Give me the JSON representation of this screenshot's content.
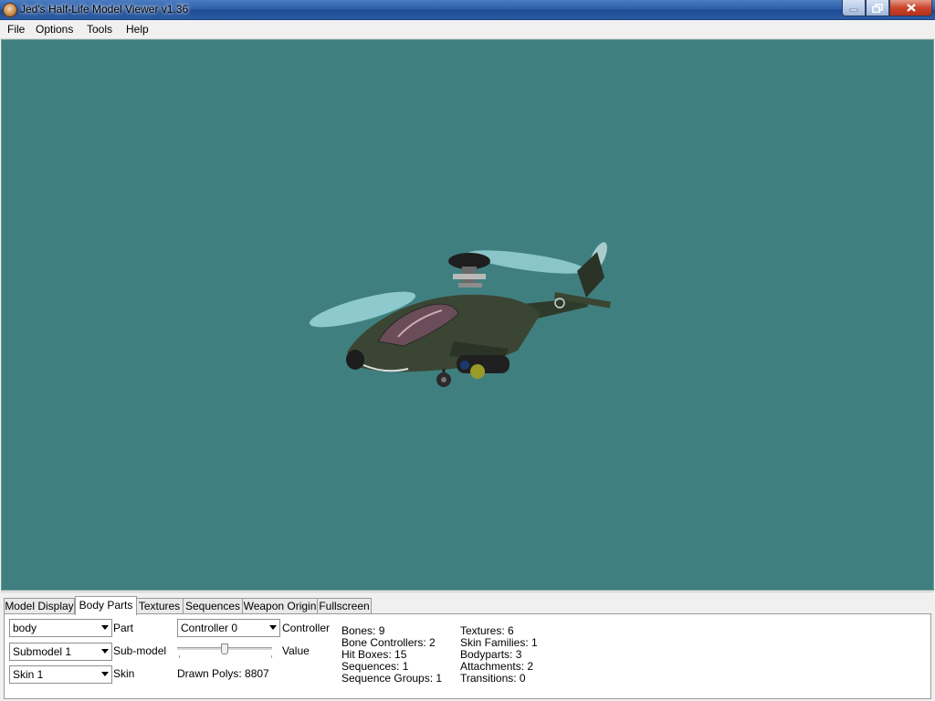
{
  "window": {
    "title": "Jed's Half-Life Model Viewer v1.36"
  },
  "menu": [
    "File",
    "Options",
    "Tools",
    "Help"
  ],
  "tabs": [
    "Model Display",
    "Body Parts",
    "Textures",
    "Sequences",
    "Weapon Origin",
    "Fullscreen"
  ],
  "active_tab": "Body Parts",
  "body_parts": {
    "part_value": "body",
    "part_label": "Part",
    "submodel_value": "Submodel 1",
    "submodel_label": "Sub-model",
    "skin_value": "Skin 1",
    "skin_label": "Skin",
    "controller_value": "Controller 0",
    "controller_label": "Controller",
    "value_label": "Value",
    "value_slider_fraction": 0.5,
    "drawn_polys": "Drawn Polys: 8807"
  },
  "stats_left": [
    "Bones: 9",
    "Bone Controllers: 2",
    "Hit Boxes: 15",
    "Sequences: 1",
    "Sequence Groups: 1"
  ],
  "stats_right": [
    "Textures: 6",
    "Skin Families: 1",
    "Bodyparts: 3",
    "Attachments: 2",
    "Transitions: 0"
  ],
  "colors": {
    "viewport_background": "#407f7f",
    "titlebar": "#2f5fa8"
  }
}
